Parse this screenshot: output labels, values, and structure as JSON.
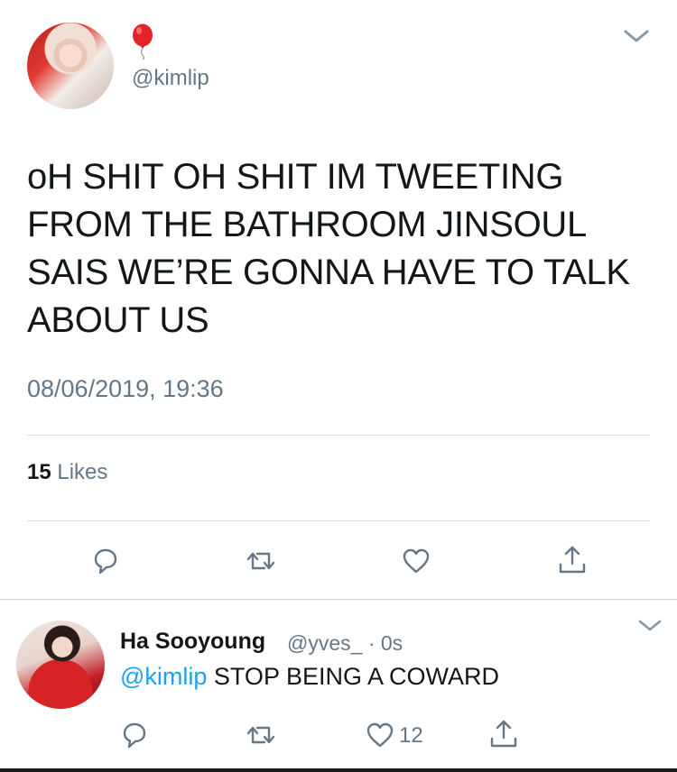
{
  "tweet": {
    "emoji": "🎈",
    "handle": "@kimlip",
    "text": "oH SHIT OH SHIT IM TWEETING\nFROM THE BATHROOM JINSOUL\nSAIS WE’RE GONNA HAVE TO TALK\nABOUT US",
    "timestamp": "08/06/2019, 19:36",
    "likes_count": "15",
    "likes_label": "Likes",
    "actions": [
      "reply-icon",
      "retweet-icon",
      "like-icon",
      "share-icon"
    ]
  },
  "reply": {
    "name": "Ha Sooyoung",
    "handle_time": "@yves_ · 0s",
    "mention": "@kimlip",
    "text": " STOP BEING A COWARD",
    "like_count": "12",
    "actions": [
      "reply-icon",
      "retweet-icon",
      "like-icon",
      "share-icon"
    ]
  },
  "colors": {
    "text": "#14171a",
    "muted": "#657786",
    "link": "#1da1f2",
    "divider": "#d6dbe0"
  }
}
